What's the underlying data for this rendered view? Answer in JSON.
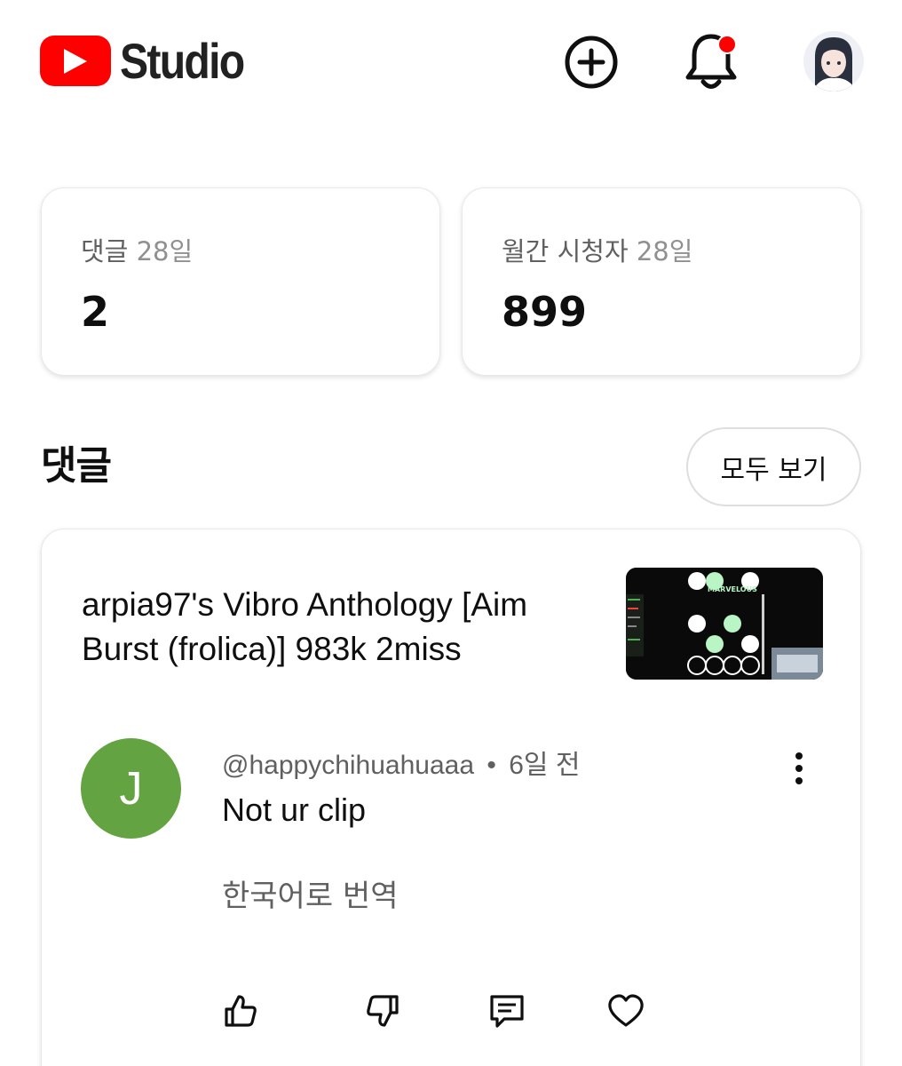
{
  "header": {
    "brand": "Studio",
    "icons": {
      "logo": "youtube-play-logo",
      "create": "plus-circle-icon",
      "notifications": "bell-icon",
      "account": "avatar"
    },
    "colors": {
      "brand_red": "#ff0000",
      "notification_dot": "#ff0000"
    }
  },
  "stats": [
    {
      "label": "댓글",
      "period": "28일",
      "value": "2"
    },
    {
      "label": "월간 시청자",
      "period": "28일",
      "value": "899"
    }
  ],
  "comments_section": {
    "title": "댓글",
    "see_all_label": "모두 보기",
    "video": {
      "title": "arpia97's Vibro Anthology [Aim Burst (frolica)] 983k 2miss",
      "thumbnail_label": "MARVELOUS"
    },
    "comment": {
      "avatar_letter": "J",
      "avatar_color": "#64a341",
      "author": "@happychihuahuaaa",
      "separator": "•",
      "time": "6일 전",
      "text": "Not ur clip",
      "translate_label": "한국어로 번역",
      "actions": [
        "thumb-up-icon",
        "thumb-down-icon",
        "reply-icon",
        "heart-icon"
      ]
    }
  }
}
